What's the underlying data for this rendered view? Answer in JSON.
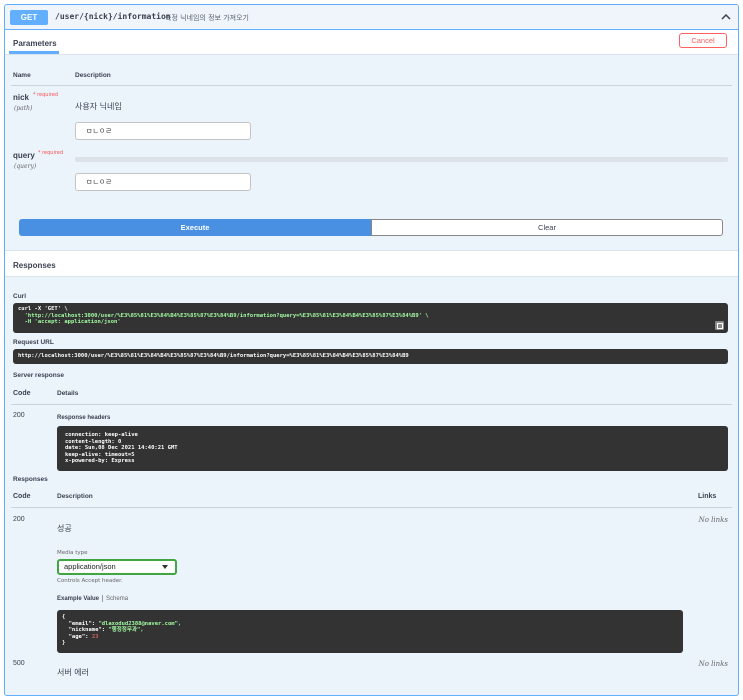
{
  "summary": {
    "method": "GET",
    "path": "/user/{nick}/information",
    "description": "특정 닉네임의 정보 가져오기"
  },
  "parameters": {
    "tab": "Parameters",
    "cancel": "Cancel",
    "col_name": "Name",
    "col_description": "Description",
    "required_label": "* required",
    "items": [
      {
        "name": "nick",
        "in": "(path)",
        "description": "사용자 닉네임",
        "value": "ㅁㄴㅇㄹ"
      },
      {
        "name": "query",
        "in": "(query)",
        "description": "",
        "value": "ㅁㄴㅇㄹ"
      }
    ]
  },
  "buttons": {
    "execute": "Execute",
    "clear": "Clear"
  },
  "responses_head": "Responses",
  "curl": {
    "label": "Curl",
    "lines": [
      "curl -X 'GET' \\",
      "  'http://localhost:3000/user/%E3%85%81%E3%84%B4%E3%85%87%E3%84%B9/information?query=%E3%85%81%E3%84%B4%E3%85%87%E3%84%B9' \\",
      "  -H 'accept: application/json'"
    ]
  },
  "request_url": {
    "label": "Request URL",
    "value": "http://localhost:3000/user/%E3%85%81%E3%84%B4%E3%85%87%E3%84%B9/information?query=%E3%85%81%E3%84%B4%E3%85%87%E3%84%B9"
  },
  "server_response": {
    "label": "Server response",
    "col_code": "Code",
    "col_details": "Details",
    "code": "200",
    "headers_label": "Response headers",
    "headers": [
      "connection: keep-alive",
      "content-length: 0",
      "date: Sun,08 Dec 2021 14:40:21 GMT",
      "keep-alive: timeout=5",
      "x-powered-by: Express"
    ]
  },
  "responses": {
    "label": "Responses",
    "col_code": "Code",
    "col_description": "Description",
    "col_links": "Links",
    "media_type_label": "Media type",
    "media_type": "application/json",
    "controls_note": "Controls Accept header.",
    "example_value": "Example Value",
    "schema": "Schema",
    "example": {
      "open": "{",
      "email_key": "  \"email\": ",
      "email_val": "\"dlaxodud2388@naver.com\",",
      "nick_key": "  \"nickname\": ",
      "nick_val": "\"행정정무과\",",
      "age_key": "  \"age\": ",
      "age_val": "23",
      "close": "}"
    },
    "rows": [
      {
        "code": "200",
        "description": "성공",
        "links": "No links"
      },
      {
        "code": "500",
        "description": "서버 에러",
        "links": "No links"
      }
    ]
  }
}
